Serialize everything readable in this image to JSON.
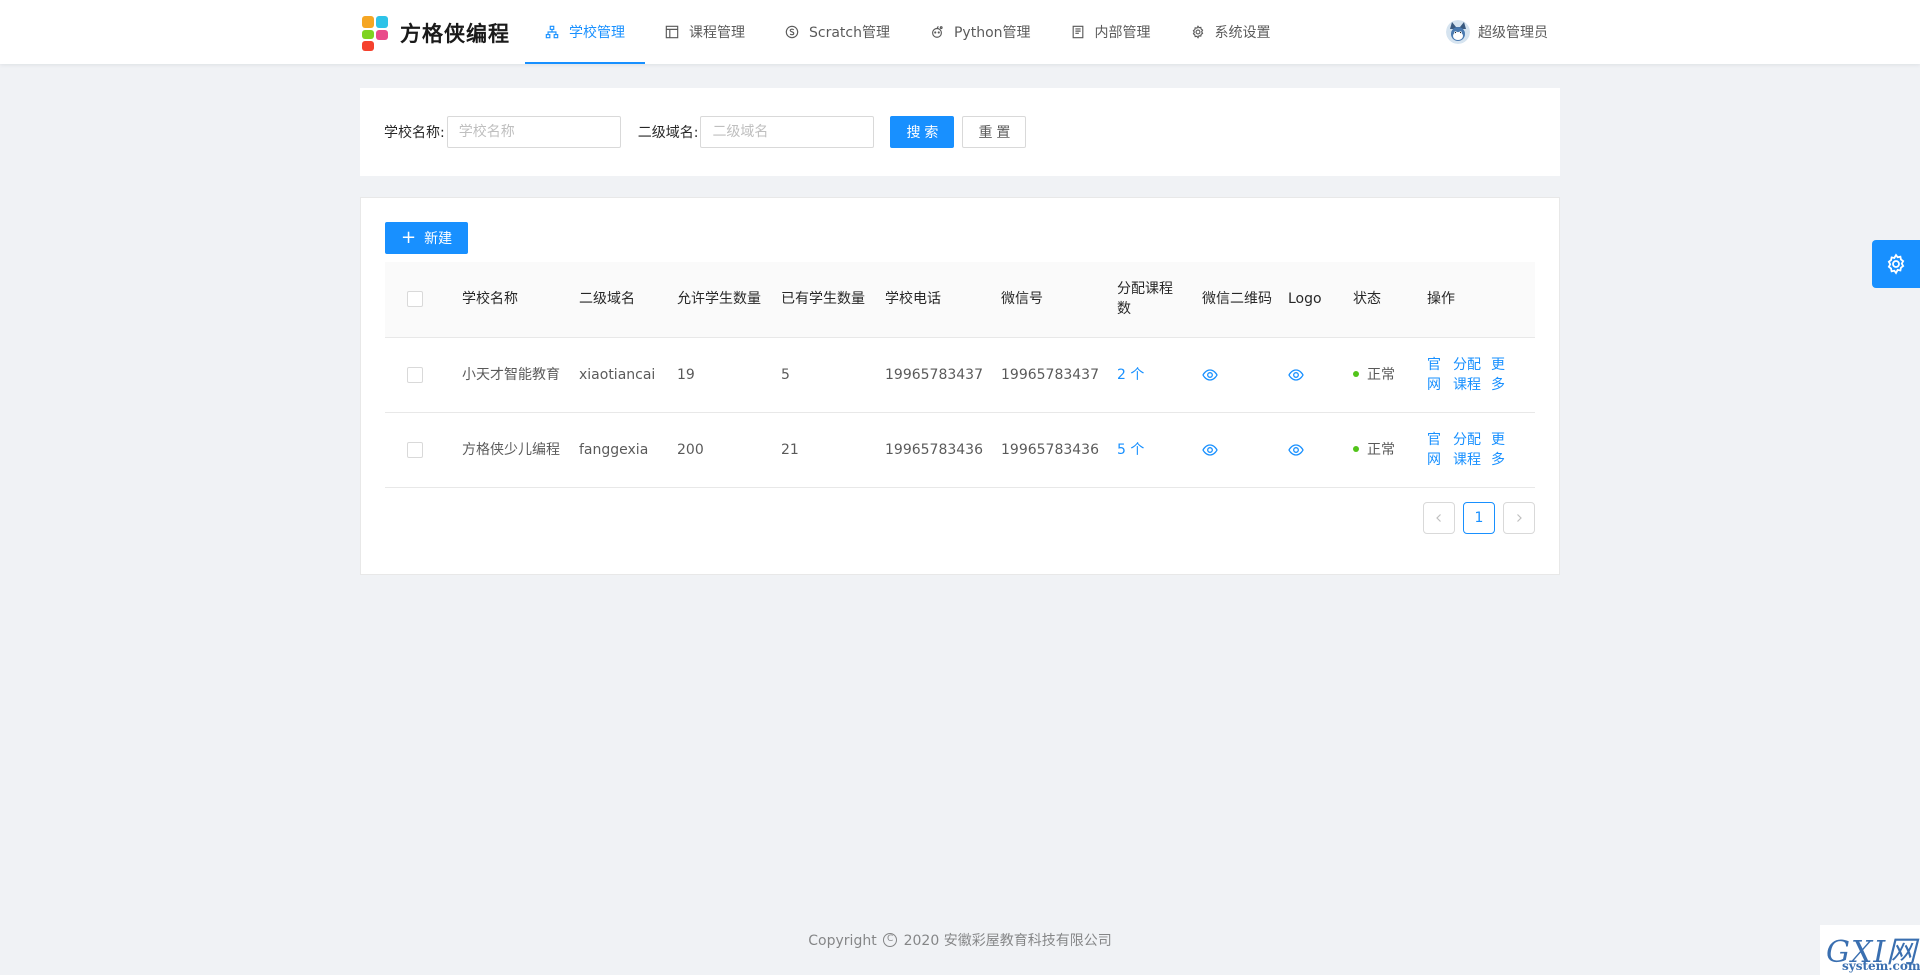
{
  "brand": {
    "name": "方格侠编程"
  },
  "nav": {
    "items": [
      {
        "label": "学校管理",
        "icon": "org-chart-icon",
        "active": true
      },
      {
        "label": "课程管理",
        "icon": "layout-icon",
        "active": false
      },
      {
        "label": "Scratch管理",
        "icon": "scratch-icon",
        "active": false
      },
      {
        "label": "Python管理",
        "icon": "python-icon",
        "active": false
      },
      {
        "label": "内部管理",
        "icon": "book-icon",
        "active": false
      },
      {
        "label": "系统设置",
        "icon": "gear-icon",
        "active": false
      }
    ]
  },
  "user": {
    "name": "超级管理员"
  },
  "search": {
    "school_label": "学校名称:",
    "school_placeholder": "学校名称",
    "domain_label": "二级域名:",
    "domain_placeholder": "二级域名",
    "search_button": "搜索",
    "reset_button": "重置"
  },
  "table": {
    "new_button": "新建",
    "columns": [
      "学校名称",
      "二级域名",
      "允许学生数量",
      "已有学生数量",
      "学校电话",
      "微信号",
      "分配课程数",
      "微信二维码",
      "Logo",
      "状态",
      "操作"
    ],
    "rows": [
      {
        "name": "小天才智能教育",
        "domain": "xiaotiancai",
        "allowed": "19",
        "current": "5",
        "phone": "19965783437",
        "wechat": "19965783437",
        "courses": "2 个",
        "status": "正常",
        "ops": [
          "官网",
          "分配课程",
          "更多"
        ]
      },
      {
        "name": "方格侠少儿编程",
        "domain": "fanggexia",
        "allowed": "200",
        "current": "21",
        "phone": "19965783436",
        "wechat": "19965783436",
        "courses": "5 个",
        "status": "正常",
        "ops": [
          "官网",
          "分配课程",
          "更多"
        ]
      }
    ]
  },
  "pagination": {
    "current": "1"
  },
  "footer": {
    "copyright_prefix": "Copyright",
    "copyright_text": "2020 安徽彩屋教育科技有限公司"
  },
  "watermark": {
    "main": "GXI网",
    "sub": "system.com"
  },
  "colors": {
    "primary": "#1890ff",
    "success": "#52c41a",
    "background": "#f0f2f5"
  }
}
